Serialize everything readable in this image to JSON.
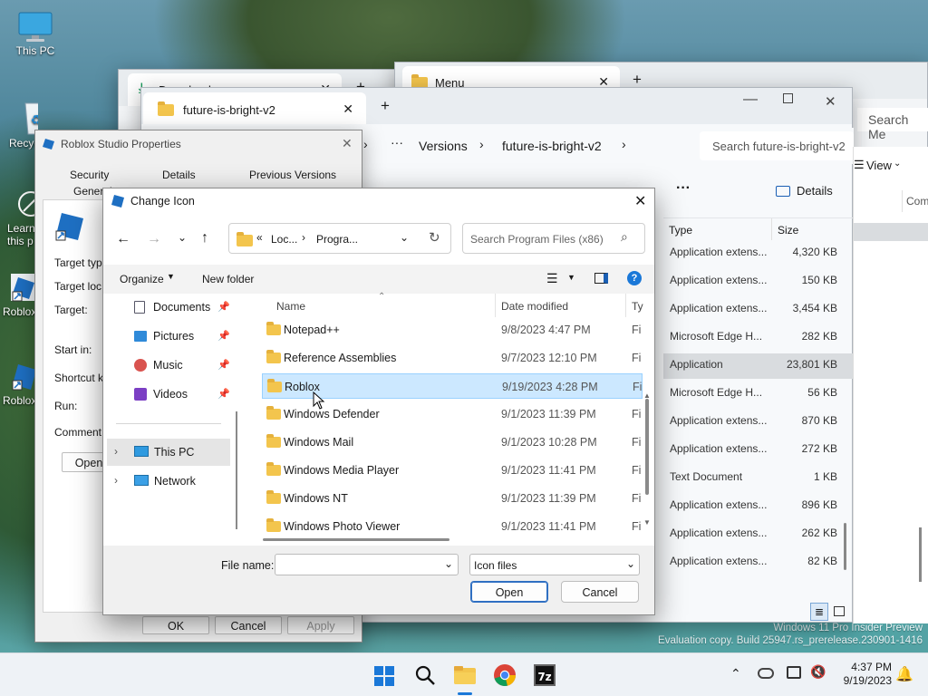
{
  "desktop": {
    "icons": [
      {
        "label": "This PC"
      },
      {
        "label": "Recycle Bin",
        "visible": "Recyc"
      },
      {
        "label": "Learn about this picture",
        "visible_1": "Learn",
        "visible_2": "this p"
      },
      {
        "label": "Roblox",
        "visible": "Roblox"
      },
      {
        "label": "Roblox",
        "visible": "Roblox"
      }
    ],
    "watermark_1": "Windows 11 Pro Insider Preview",
    "watermark_2": "Evaluation copy. Build 25947.rs_prerelease.230901-1416"
  },
  "back_windows": {
    "downloads_tab": "Downloads",
    "menu_tab": "Menu",
    "search_me": "Search Me"
  },
  "explorer": {
    "tab_title": "future-is-bright-v2",
    "breadcrumb": [
      "Versions",
      "future-is-bright-v2"
    ],
    "search_placeholder": "Search future-is-bright-v2",
    "view_label": "View",
    "details_label": "Details",
    "col_type": "Type",
    "col_size": "Size",
    "col_comment": "Com",
    "rows": [
      {
        "type": "Application extens...",
        "size": "4,320 KB"
      },
      {
        "type": "Application extens...",
        "size": "150 KB"
      },
      {
        "type": "Application extens...",
        "size": "3,454 KB"
      },
      {
        "type": "Microsoft Edge H...",
        "size": "282 KB"
      },
      {
        "type": "Application",
        "size": "23,801 KB"
      },
      {
        "type": "Microsoft Edge H...",
        "size": "56 KB"
      },
      {
        "type": "Application extens...",
        "size": "870 KB"
      },
      {
        "type": "Application extens...",
        "size": "272 KB"
      },
      {
        "type": "Text Document",
        "size": "1 KB"
      },
      {
        "type": "Application extens...",
        "size": "896 KB"
      },
      {
        "type": "Application extens...",
        "size": "262 KB"
      },
      {
        "type": "Application extens...",
        "size": "82 KB"
      }
    ]
  },
  "props": {
    "title": "Roblox Studio Properties",
    "tabs_row1": [
      "Security",
      "Details",
      "Previous Versions"
    ],
    "tabs_row2": [
      "General",
      "Shortcut"
    ],
    "labels": [
      "Target type:",
      "Target location:",
      "Target:",
      "Start in:",
      "Shortcut key:",
      "Run:",
      "Comment:"
    ],
    "labels_visible": [
      "Target typ",
      "Target loc",
      "Target:",
      "Start in:",
      "Shortcut k",
      "Run:",
      "Comment:"
    ],
    "open_btn": "Open",
    "ok": "OK",
    "cancel": "Cancel",
    "apply": "Apply"
  },
  "dialog": {
    "title": "Change Icon",
    "address_parts": [
      "Loc...",
      "Progra..."
    ],
    "search_placeholder": "Search Program Files (x86)",
    "organize": "Organize",
    "new_folder": "New folder",
    "col_name": "Name",
    "col_date": "Date modified",
    "col_type": "Ty",
    "nav": [
      {
        "label": "Documents",
        "icon": "documents-icon"
      },
      {
        "label": "Pictures",
        "icon": "pictures-icon"
      },
      {
        "label": "Music",
        "icon": "music-icon"
      },
      {
        "label": "Videos",
        "icon": "videos-icon"
      },
      {
        "label": "This PC",
        "icon": "this-pc-icon"
      },
      {
        "label": "Network",
        "icon": "network-icon"
      }
    ],
    "files": [
      {
        "name": "Notepad++",
        "date": "9/8/2023 4:47 PM",
        "type": "Fi"
      },
      {
        "name": "Reference Assemblies",
        "date": "9/7/2023 12:10 PM",
        "type": "Fi"
      },
      {
        "name": "Roblox",
        "date": "9/19/2023 4:28 PM",
        "type": "Fi",
        "selected": true
      },
      {
        "name": "Windows Defender",
        "date": "9/1/2023 11:39 PM",
        "type": "Fi"
      },
      {
        "name": "Windows Mail",
        "date": "9/1/2023 10:28 PM",
        "type": "Fi"
      },
      {
        "name": "Windows Media Player",
        "date": "9/1/2023 11:41 PM",
        "type": "Fi"
      },
      {
        "name": "Windows NT",
        "date": "9/1/2023 11:39 PM",
        "type": "Fi"
      },
      {
        "name": "Windows Photo Viewer",
        "date": "9/1/2023 11:41 PM",
        "type": "Fi"
      }
    ],
    "file_name_label": "File name:",
    "file_name_value": "",
    "filter_value": "Icon files",
    "open": "Open",
    "cancel": "Cancel"
  },
  "taskbar": {
    "time": "4:37 PM",
    "date": "9/19/2023",
    "apps": [
      "start-icon",
      "search-icon",
      "file-explorer-icon",
      "chrome-icon",
      "7zip-icon"
    ],
    "zip_label": "7z"
  },
  "colors": {
    "accent": "#0067c0",
    "selection": "#cce8ff",
    "folder": "#f3c54d"
  }
}
